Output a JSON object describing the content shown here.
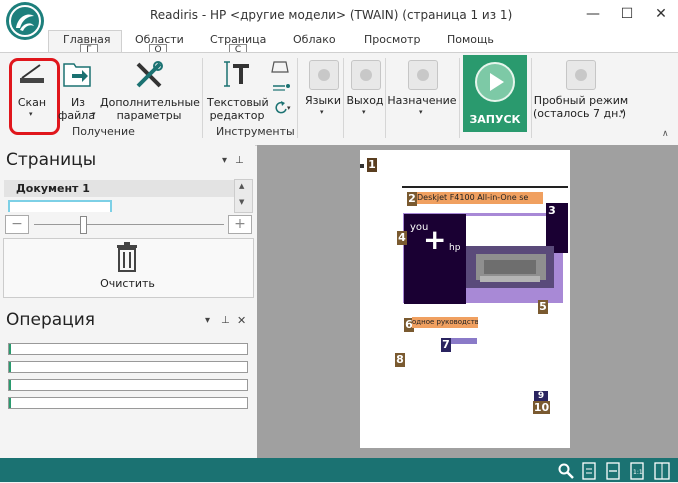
{
  "window": {
    "title": "Readiris - HP <другие модели> (TWAIN) (страница 1 из 1)",
    "minimize_glyph": "—",
    "maximize_glyph": "☐",
    "close_glyph": "✕"
  },
  "tabs": [
    {
      "label": "Главная",
      "keytip": "Г"
    },
    {
      "label": "Области",
      "keytip": "О"
    },
    {
      "label": "Страница",
      "keytip": "С"
    },
    {
      "label": "Облако"
    },
    {
      "label": "Просмотр"
    },
    {
      "label": "Помощь"
    }
  ],
  "ribbon": {
    "scan_label": "Скан",
    "from_file_label_1": "Из",
    "from_file_label_2": "файла",
    "extra_params_label_1": "Дополнительные",
    "extra_params_label_2": "параметры",
    "group_receive": "Получение",
    "text_editor_label_1": "Текстовый",
    "text_editor_label_2": "редактор",
    "group_tools": "Инструменты",
    "languages_label": "Языки",
    "output_label": "Выход",
    "destination_label": "Назначение",
    "run_label": "ЗАПУСК",
    "trial_label_1": "Пробный режим",
    "trial_label_2": "(осталось 7 дн.)",
    "caret": "▾"
  },
  "pages_panel": {
    "title": "Страницы",
    "document_label": "Документ 1",
    "clear_label": "Очистить",
    "zoom_minus": "−",
    "zoom_plus": "+",
    "zoom_level": 0.26
  },
  "operation_panel": {
    "title": "Операция",
    "progress": [
      0.01,
      0.01,
      0.01,
      0.01
    ]
  },
  "panel_controls": {
    "dropdown": "▾",
    "pin": "⊥",
    "close": "✕"
  },
  "zones": {
    "n1": "1",
    "n2": "2",
    "n3": "3",
    "n4": "4",
    "n5": "5",
    "n6": "6",
    "n7": "7",
    "n8": "8",
    "n9": "9",
    "n10": "10",
    "heading_text": "Deskjet F4100 All-in-One se",
    "logo_you": "you",
    "logo_hp": "hp",
    "guide_text": "одное руководство"
  },
  "colors": {
    "accent": "#1b7272",
    "run_button": "#2a9a6e",
    "scan_highlight": "#e0161c",
    "zone_number_bg": "#7a5a30",
    "zone_text_bg": "#f0a060",
    "zone_image_bg": "#1a0033"
  }
}
